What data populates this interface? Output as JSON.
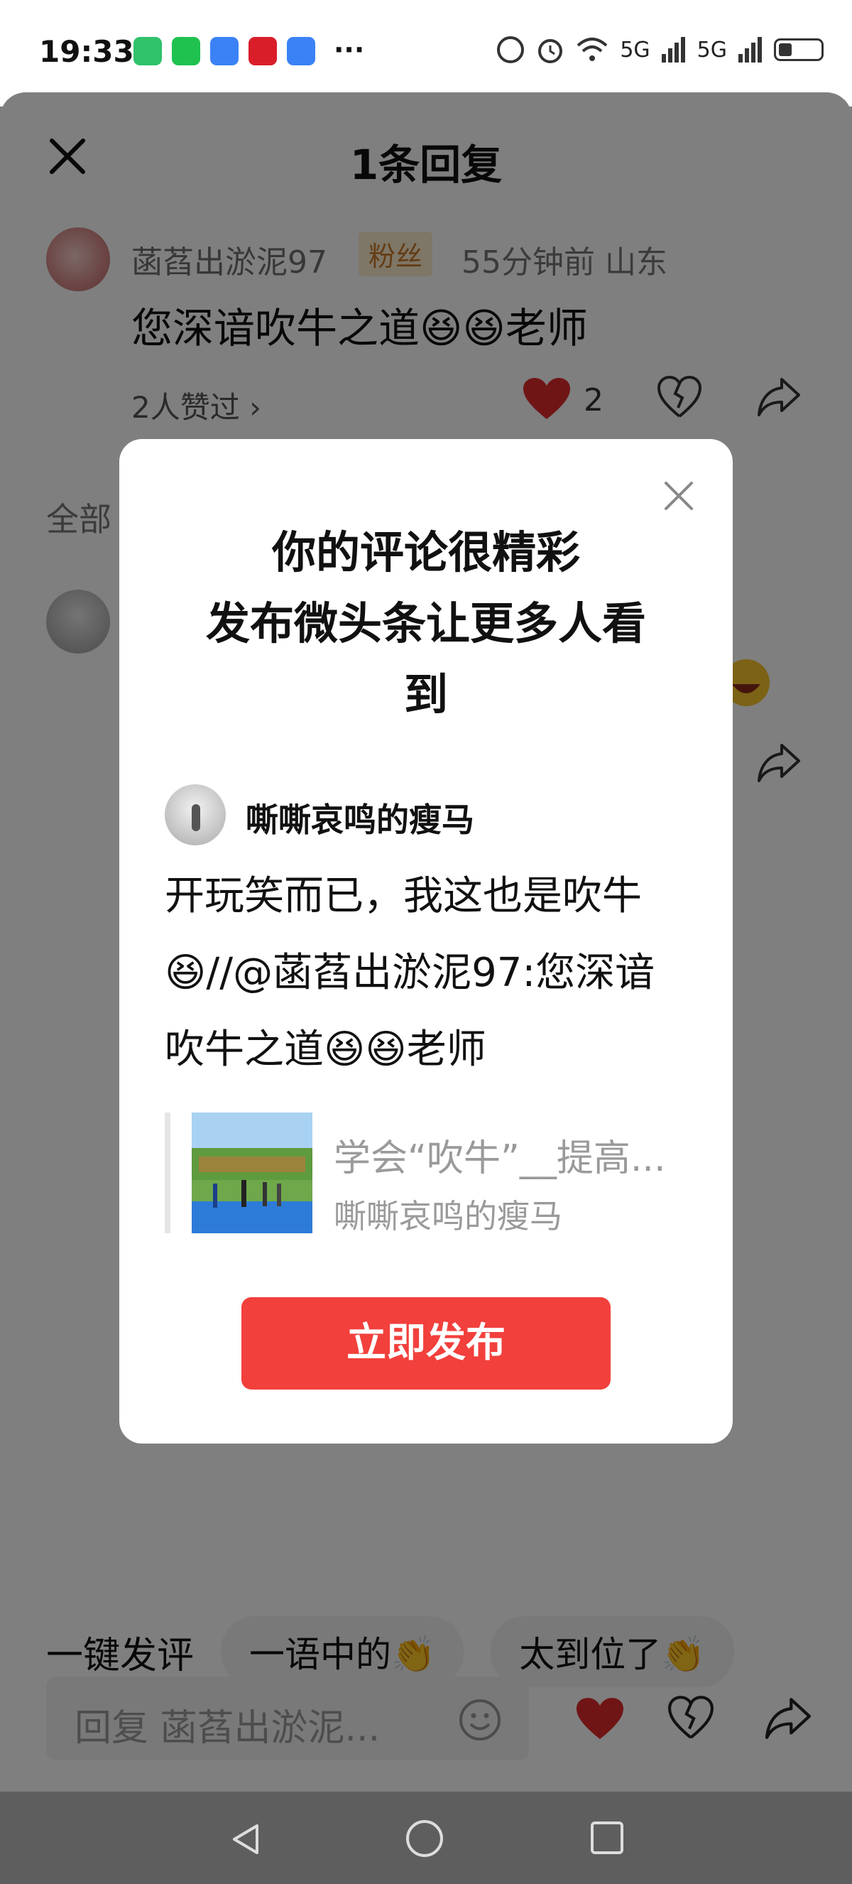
{
  "status_bar": {
    "time": "19:33",
    "network_1": "5G",
    "network_2": "5G"
  },
  "header": {
    "title": "1条回复"
  },
  "comment": {
    "username": "菡萏出淤泥97",
    "badge": "粉丝",
    "meta": "55分钟前  山东",
    "text": "您深谙吹牛之道😆😆老师",
    "likers": "2人赞过 ›",
    "like_count": "2"
  },
  "all_replies_label": "全部",
  "modal": {
    "title_line1": "你的评论很精彩",
    "title_line2": "发布微头条让更多人看",
    "title_line3": "到",
    "username": "嘶嘶哀鸣的瘦马",
    "body": "开玩笑而已，我这也是吹牛😆//@菡萏出淤泥97:您深谙吹牛之道😆😆老师",
    "article_title": "学会“吹牛”__提高...",
    "article_author": "嘶嘶哀鸣的瘦马",
    "publish_button": "立即发布"
  },
  "quick_reply": {
    "label": "一键发评",
    "chips": [
      "一语中的👏",
      "太到位了👏"
    ]
  },
  "reply_input": {
    "placeholder": "回复 菡萏出淤泥..."
  },
  "colors": {
    "accent_red": "#f2403c",
    "heart_red": "#e02b2b"
  }
}
